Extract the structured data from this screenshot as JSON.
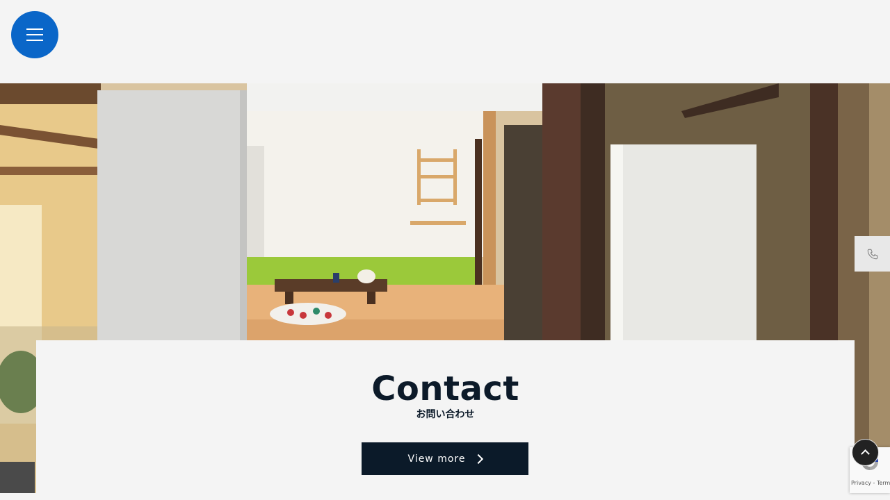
{
  "header": {
    "menu_label": "menu"
  },
  "contact": {
    "title": "Contact",
    "subtitle": "お問い合わせ",
    "button_label": "View more"
  },
  "side": {
    "phone_icon": "phone-icon"
  },
  "recaptcha": {
    "terms": "Privacy - Terms"
  },
  "colors": {
    "menu_button": "#0a66c8",
    "dark_navy": "#0b1a29",
    "background": "#f4f4f4",
    "accent_green": "#9bc93a"
  }
}
